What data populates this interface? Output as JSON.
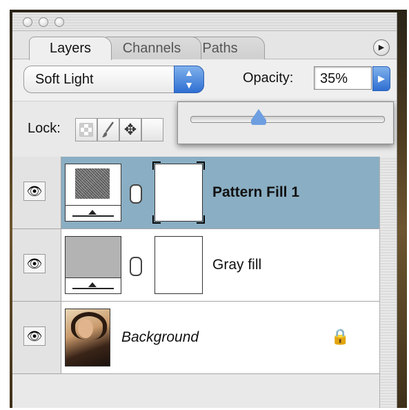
{
  "tabs": [
    {
      "label": "Layers",
      "active": true
    },
    {
      "label": "Channels",
      "active": false
    },
    {
      "label": "Paths",
      "active": false
    }
  ],
  "panel_menu_icon": "triangle-right-icon",
  "blend_mode": {
    "value": "Soft Light"
  },
  "opacity": {
    "label": "Opacity:",
    "value": "35%",
    "slider_level": 0.35
  },
  "lock": {
    "label": "Lock:",
    "icons": [
      "transparency-lock-icon",
      "brush-icon",
      "move-icon"
    ]
  },
  "layers": [
    {
      "name": "Pattern Fill 1",
      "type": "pattern-fill",
      "selected": true,
      "visible": true
    },
    {
      "name": "Gray fill",
      "type": "solid-fill",
      "selected": false,
      "visible": true
    },
    {
      "name": "Background",
      "type": "image",
      "selected": false,
      "visible": true,
      "locked": true
    }
  ],
  "colors": {
    "selected_row": "#8aaec3",
    "accent_blue": "#2f6fd2",
    "gray_fill": "#b3b3b3"
  }
}
